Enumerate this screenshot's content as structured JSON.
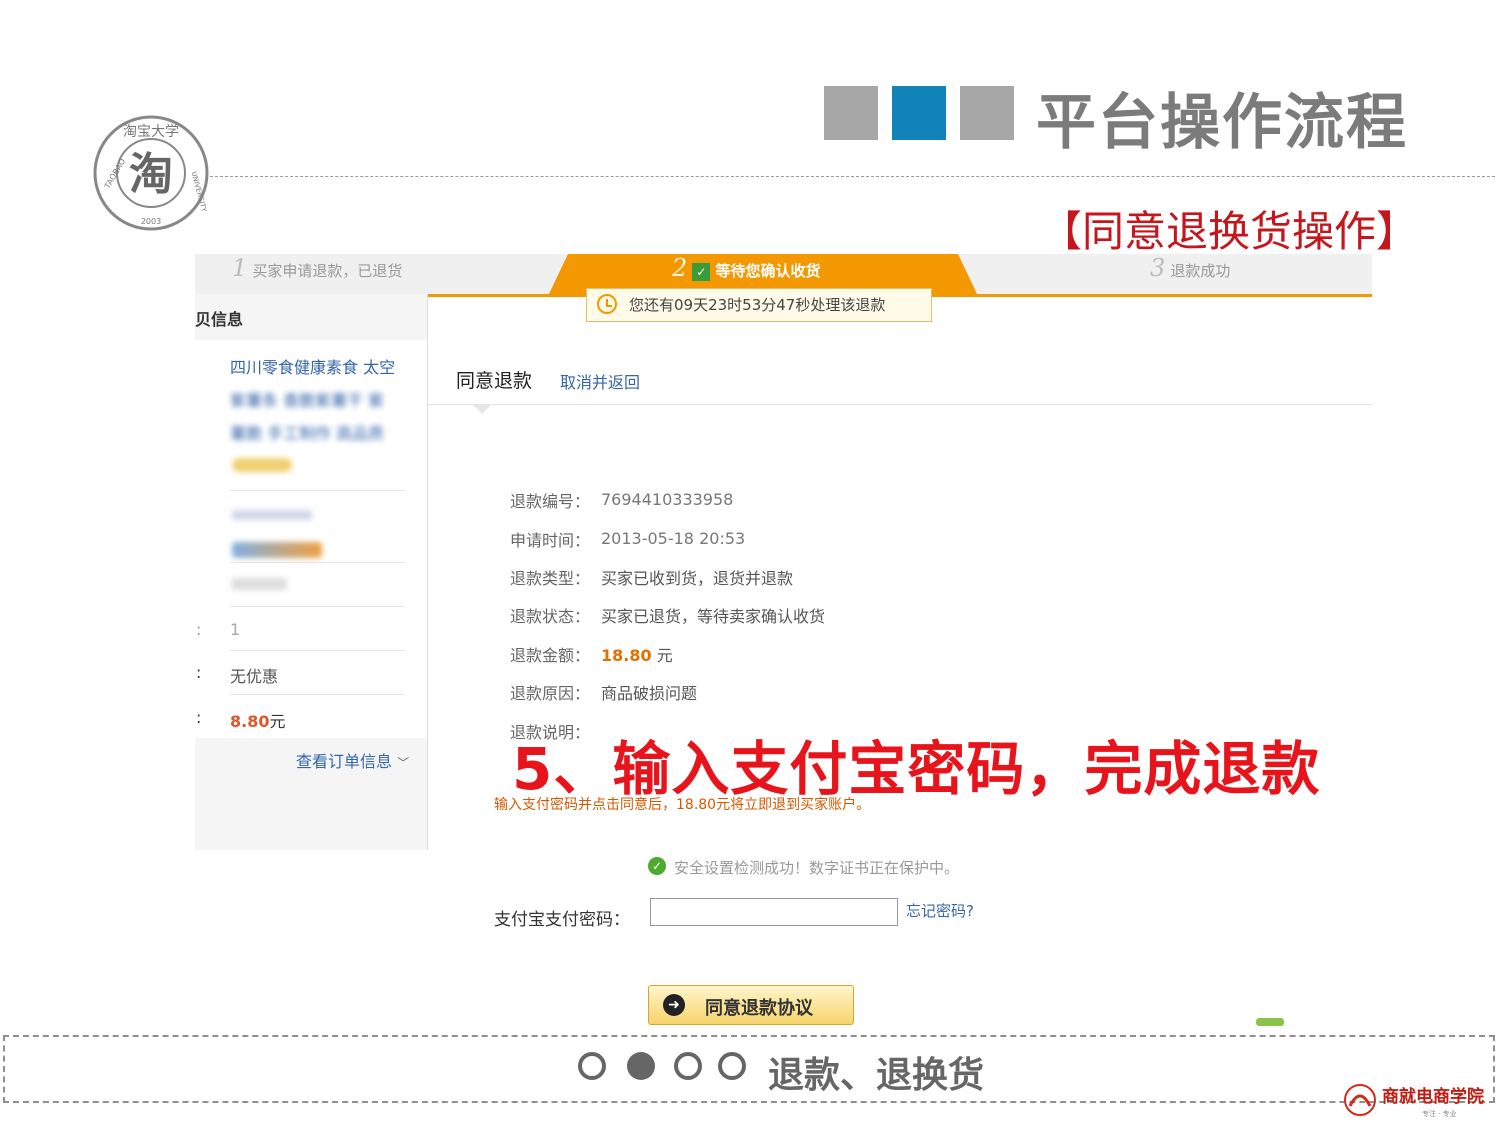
{
  "slide": {
    "title": "平台操作流程",
    "subtitle": "【同意退换货操作】",
    "footer_text": "退款、退换货",
    "colors": {
      "accent_blue": "#1283b8",
      "square_gray": "#a6a6a6",
      "title_gray": "#7b7b7b",
      "highlight_red": "#e8141c",
      "step_orange": "#f39800"
    },
    "logo_text": {
      "top_chars": "淘宝大学",
      "center_char": "淘",
      "ring_left": "TAOBAO",
      "ring_bottom": "2003",
      "ring_right": "UNIVERSITY"
    },
    "brand_logo_text": "商就电商学院",
    "brand_logo_subtext": "专注 · 专业"
  },
  "steps": [
    {
      "num": "1",
      "label": "买家申请退款，已退货"
    },
    {
      "num": "2",
      "label": "等待您确认收货"
    },
    {
      "num": "3",
      "label": "退款成功"
    }
  ],
  "timer_text": "您还有09天23时53分47秒处理该退款",
  "left_panel": {
    "header": "贝信息",
    "product_lines": [
      "四川零食健康素食 太空",
      "紫薯条 香脆紫薯干 紫",
      "薯脆 手工制作 高品质"
    ],
    "rows": [
      {
        "value": "1"
      },
      {
        "value": "无优惠"
      },
      {
        "value": "8.80",
        "unit": "元"
      }
    ],
    "view_order_link": "查看订单信息"
  },
  "tabs": {
    "active": "同意退款",
    "cancel": "取消并返回"
  },
  "refund": {
    "fields": [
      {
        "label": "退款编号：",
        "value": "7694410333958"
      },
      {
        "label": "申请时间：",
        "value": "2013-05-18 20:53"
      },
      {
        "label": "退款类型：",
        "value": "买家已收到货，退货并退款"
      },
      {
        "label": "退款状态：",
        "value": "买家已退货，等待卖家确认收货"
      },
      {
        "label": "退款金额：",
        "value": "18.80",
        "unit": "元"
      },
      {
        "label": "退款原因：",
        "value": "商品破损问题"
      },
      {
        "label": "退款说明：",
        "value": ""
      }
    ],
    "step_callout": "5、输入支付宝密码，完成退款",
    "note": "输入支付密码并点击同意后，18.80元将立即退到买家账户。",
    "security_text": "安全设置检测成功！数字证书正在保护中。",
    "password_label": "支付宝支付密码：",
    "password_value": "",
    "forgot_link": "忘记密码?",
    "agree_button": "同意退款协议"
  }
}
